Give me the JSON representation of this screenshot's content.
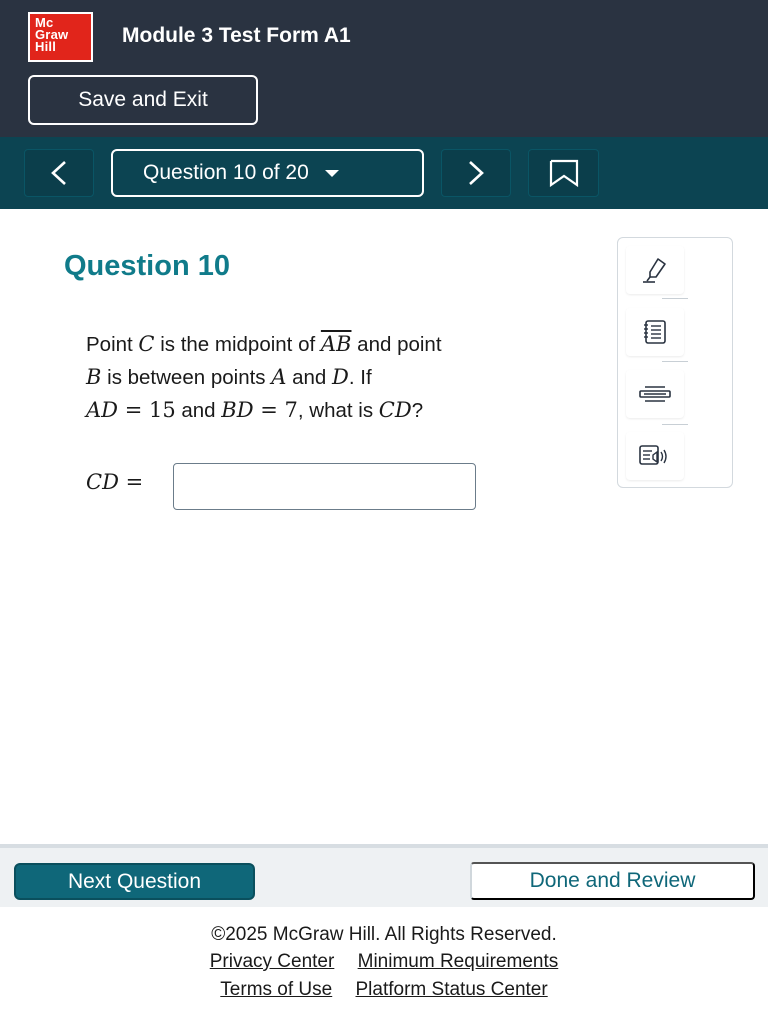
{
  "header": {
    "logo_lines": [
      "Mc",
      "Graw",
      "Hill"
    ],
    "title": "Module 3 Test Form A1",
    "save_exit_label": "Save and Exit"
  },
  "question_nav": {
    "selector_label": "Question 10 of 20",
    "prev_icon": "chevron-left-icon",
    "next_icon": "chevron-right-icon",
    "bookmark_icon": "bookmark-icon"
  },
  "question": {
    "heading": "Question 10",
    "text_parts": {
      "p1": "Point ",
      "var_c": "C",
      "p2": " is the midpoint of ",
      "seg_ab": "AB",
      "p3": " and point",
      "var_b": "B",
      "p4": " is between points ",
      "var_a": "A",
      "p5": " and ",
      "var_d": "D",
      "p6": ". If",
      "ad": "AD",
      "eq1": " = 15",
      "p7": " and ",
      "bd": "BD",
      "eq2": " = 7",
      "p8": ", what is ",
      "cd": "CD",
      "p9": "?"
    },
    "answer_label_var": "CD",
    "answer_label_eq": " =",
    "answer_value": ""
  },
  "tools": [
    {
      "name": "highlighter-icon"
    },
    {
      "name": "notepad-icon"
    },
    {
      "name": "line-reader-icon"
    },
    {
      "name": "text-to-speech-icon"
    }
  ],
  "footer": {
    "next_label": "Next Question",
    "done_label": "Done and Review",
    "copyright": "©2025 McGraw Hill. All Rights Reserved.",
    "links": {
      "privacy": "Privacy Center",
      "min_req": "Minimum Requirements",
      "terms": "Terms of Use",
      "status": "Platform Status Center"
    }
  },
  "colors": {
    "header_bg": "#2a3341",
    "nav_bg": "#0c4452",
    "accent_teal": "#107b8a",
    "brand_red": "#e1251b",
    "button_teal": "#0f6779"
  }
}
